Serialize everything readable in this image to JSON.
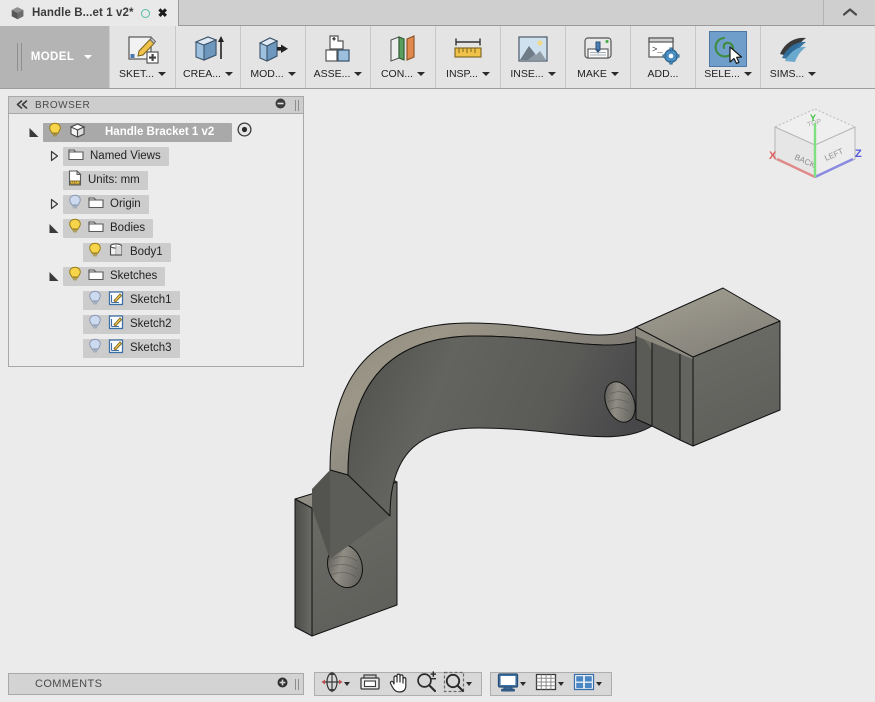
{
  "titlebar": {
    "tab_title": "Handle B...et 1 v2*",
    "tab_icon": "cube-icon",
    "save_indicator": "unsaved-dot-icon",
    "close_label": "✖",
    "collapse_icon": "chevron-up-icon"
  },
  "ribbon": {
    "workspace": {
      "label": "MODEL",
      "caret": "chevron-down-icon"
    },
    "tools": [
      {
        "label": "SKET...",
        "icon": "sketch-icon",
        "has_caret": true,
        "active": false
      },
      {
        "label": "CREA...",
        "icon": "create-extrude-icon",
        "has_caret": true,
        "active": false
      },
      {
        "label": "MOD...",
        "icon": "modify-pushpull-icon",
        "has_caret": true,
        "active": false
      },
      {
        "label": "ASSE...",
        "icon": "assemble-icon",
        "has_caret": true,
        "active": false
      },
      {
        "label": "CON...",
        "icon": "construct-plane-icon",
        "has_caret": true,
        "active": false
      },
      {
        "label": "INSP...",
        "icon": "inspect-measure-icon",
        "has_caret": true,
        "active": false
      },
      {
        "label": "INSE...",
        "icon": "insert-image-icon",
        "has_caret": true,
        "active": false
      },
      {
        "label": "MAKE",
        "icon": "make-3dprint-icon",
        "has_caret": true,
        "active": false
      },
      {
        "label": "ADD...",
        "icon": "addins-script-icon",
        "has_caret": false,
        "active": false
      },
      {
        "label": "SELE...",
        "icon": "select-lasso-icon",
        "has_caret": true,
        "active": true
      },
      {
        "label": "SIMS...",
        "icon": "simulation-icon",
        "has_caret": true,
        "active": false
      }
    ]
  },
  "browser": {
    "header_title": "BROWSER",
    "collapse_icon": "double-chevron-left-icon",
    "minimize_icon": "minus-circle-icon",
    "tree": [
      {
        "label": "Handle Bracket 1 v2",
        "indent": 1,
        "twisty": "expanded",
        "bulb": "on",
        "icon": "body-cube-icon",
        "root": true,
        "target": "activate-target-icon"
      },
      {
        "label": "Named Views",
        "indent": 2,
        "twisty": "collapsed",
        "bulb": "none",
        "icon": "folder-icon",
        "root": false
      },
      {
        "label": "Units: mm",
        "indent": 2,
        "twisty": "none",
        "bulb": "none",
        "icon": "units-document-icon",
        "root": false
      },
      {
        "label": "Origin",
        "indent": 2,
        "twisty": "collapsed",
        "bulb": "off",
        "icon": "folder-icon",
        "root": false
      },
      {
        "label": "Bodies",
        "indent": 2,
        "twisty": "expanded",
        "bulb": "on",
        "icon": "folder-icon",
        "root": false
      },
      {
        "label": "Body1",
        "indent": 3,
        "twisty": "none",
        "bulb": "on",
        "icon": "body-cylinder-icon",
        "root": false
      },
      {
        "label": "Sketches",
        "indent": 2,
        "twisty": "expanded",
        "bulb": "on",
        "icon": "folder-icon",
        "root": false
      },
      {
        "label": "Sketch1",
        "indent": 3,
        "twisty": "none",
        "bulb": "off",
        "icon": "sketch-small-icon",
        "root": false
      },
      {
        "label": "Sketch2",
        "indent": 3,
        "twisty": "none",
        "bulb": "off",
        "icon": "sketch-small-icon",
        "root": false
      },
      {
        "label": "Sketch3",
        "indent": 3,
        "twisty": "none",
        "bulb": "off",
        "icon": "sketch-small-icon",
        "root": false
      }
    ]
  },
  "canvas": {
    "viewcube": {
      "face_top": "TOP",
      "face_front": "BACK",
      "face_right": "LEFT",
      "axis_x": "X",
      "axis_y": "Y",
      "axis_z": "Z",
      "color_x": "#e05b5b",
      "color_y": "#3fc13f",
      "color_z": "#5555dd"
    },
    "model": {
      "name": "handle-bracket-3d-model",
      "description": "U-shaped saddle clamp bracket with two mounting flanges, each with a through hole"
    }
  },
  "comments": {
    "label": "COMMENTS",
    "add_icon": "plus-circle-icon"
  },
  "navbar": {
    "groups": [
      [
        {
          "icon": "orbit-icon",
          "caret": true
        },
        {
          "icon": "look-at-icon",
          "caret": false
        },
        {
          "icon": "pan-hand-icon",
          "caret": false
        },
        {
          "icon": "zoom-magnifier-icon",
          "caret": false
        },
        {
          "icon": "zoom-window-icon",
          "caret": true
        }
      ],
      [
        {
          "icon": "display-settings-icon",
          "caret": true
        },
        {
          "icon": "grid-snaps-icon",
          "caret": true
        },
        {
          "icon": "viewport-layout-icon",
          "caret": true
        }
      ]
    ]
  },
  "theme": {
    "canvas_bg": "#ebebeb",
    "ribbon_bg": "#e4e4e4",
    "accent_active": "#6f9ecb",
    "model_gray": "#6b6b66"
  }
}
